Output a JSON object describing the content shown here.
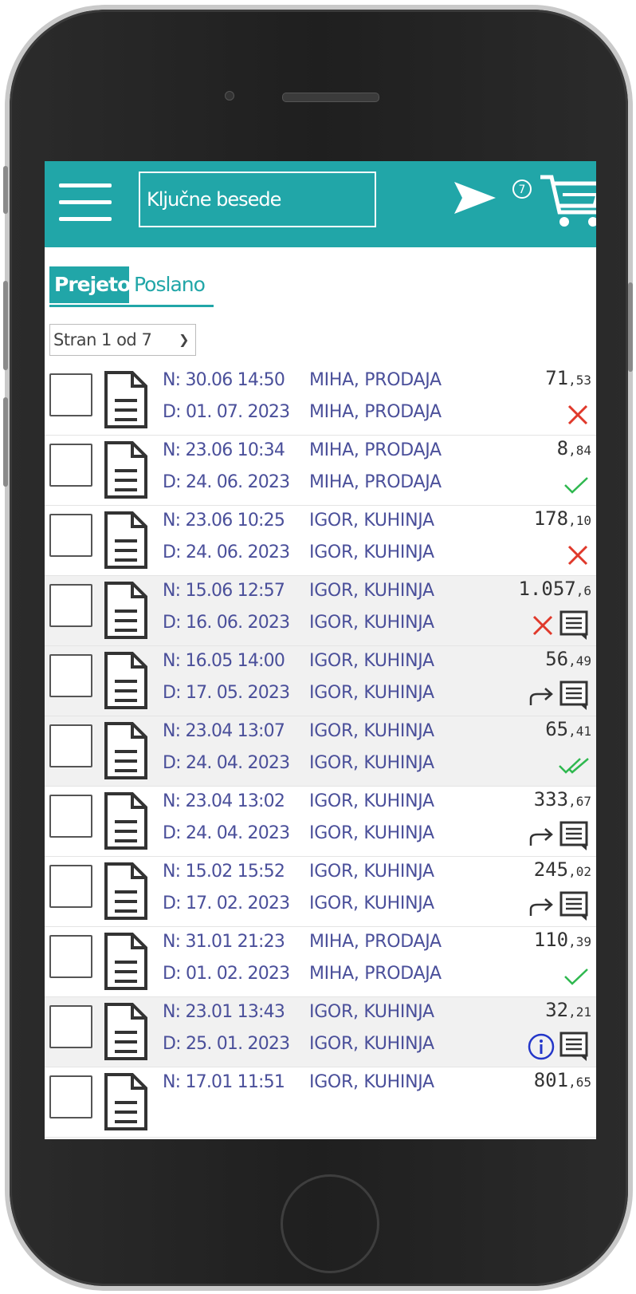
{
  "header": {
    "search_placeholder": "Ključne besede",
    "cart_count": "7"
  },
  "tabs": [
    {
      "label": "Prejeto",
      "active": true
    },
    {
      "label": "Poslano",
      "active": false
    }
  ],
  "pager": {
    "label": "Stran 1 od 7"
  },
  "rows": [
    {
      "ordered": "N: 30.06 14:50",
      "delivery": "D: 01. 07. 2023",
      "customer1": "MIHA, PRODAJA",
      "customer2": "MIHA, PRODAJA",
      "amount_int": "71",
      "amount_dec": ",53",
      "status": "rejected",
      "comment": false,
      "shaded": false
    },
    {
      "ordered": "N: 23.06 10:34",
      "delivery": "D: 24. 06. 2023",
      "customer1": "MIHA, PRODAJA",
      "customer2": "MIHA, PRODAJA",
      "amount_int": "8",
      "amount_dec": ",84",
      "status": "confirmed",
      "comment": false,
      "shaded": false
    },
    {
      "ordered": "N: 23.06 10:25",
      "delivery": "D: 24. 06. 2023",
      "customer1": "IGOR, KUHINJA",
      "customer2": "IGOR, KUHINJA",
      "amount_int": "178",
      "amount_dec": ",10",
      "status": "rejected",
      "comment": false,
      "shaded": false
    },
    {
      "ordered": "N: 15.06 12:57",
      "delivery": "D: 16. 06. 2023",
      "customer1": "IGOR, KUHINJA",
      "customer2": "IGOR, KUHINJA",
      "amount_int": "1.057",
      "amount_dec": ",6",
      "status": "rejected",
      "comment": true,
      "shaded": true
    },
    {
      "ordered": "N: 16.05 14:00",
      "delivery": "D: 17. 05. 2023",
      "customer1": "IGOR, KUHINJA",
      "customer2": "IGOR, KUHINJA",
      "amount_int": "56",
      "amount_dec": ",49",
      "status": "forwarded",
      "comment": true,
      "shaded": true
    },
    {
      "ordered": "N: 23.04 13:07",
      "delivery": "D: 24. 04. 2023",
      "customer1": "IGOR, KUHINJA",
      "customer2": "IGOR, KUHINJA",
      "amount_int": "65",
      "amount_dec": ",41",
      "status": "delivered",
      "comment": false,
      "shaded": true
    },
    {
      "ordered": "N: 23.04 13:02",
      "delivery": "D: 24. 04. 2023",
      "customer1": "IGOR, KUHINJA",
      "customer2": "IGOR, KUHINJA",
      "amount_int": "333",
      "amount_dec": ",67",
      "status": "forwarded",
      "comment": true,
      "shaded": false
    },
    {
      "ordered": "N: 15.02 15:52",
      "delivery": "D: 17. 02. 2023",
      "customer1": "IGOR, KUHINJA",
      "customer2": "IGOR, KUHINJA",
      "amount_int": "245",
      "amount_dec": ",02",
      "status": "forwarded",
      "comment": true,
      "shaded": false
    },
    {
      "ordered": "N: 31.01 21:23",
      "delivery": "D: 01. 02. 2023",
      "customer1": "MIHA, PRODAJA",
      "customer2": "MIHA, PRODAJA",
      "amount_int": "110",
      "amount_dec": ",39",
      "status": "confirmed",
      "comment": false,
      "shaded": false
    },
    {
      "ordered": "N: 23.01 13:43",
      "delivery": "D: 25. 01. 2023",
      "customer1": "IGOR, KUHINJA",
      "customer2": "IGOR, KUHINJA",
      "amount_int": "32",
      "amount_dec": ",21",
      "status": "info",
      "comment": true,
      "shaded": true
    },
    {
      "ordered": "N: 17.01 11:51",
      "delivery": "",
      "customer1": "IGOR, KUHINJA",
      "customer2": "",
      "amount_int": "801",
      "amount_dec": ",65",
      "status": "",
      "comment": false,
      "shaded": false
    }
  ],
  "colors": {
    "accent": "#21a6a8",
    "reject": "#e0392b",
    "ok": "#2fb84f",
    "info": "#2437c9",
    "text": "#4a4f9a"
  }
}
